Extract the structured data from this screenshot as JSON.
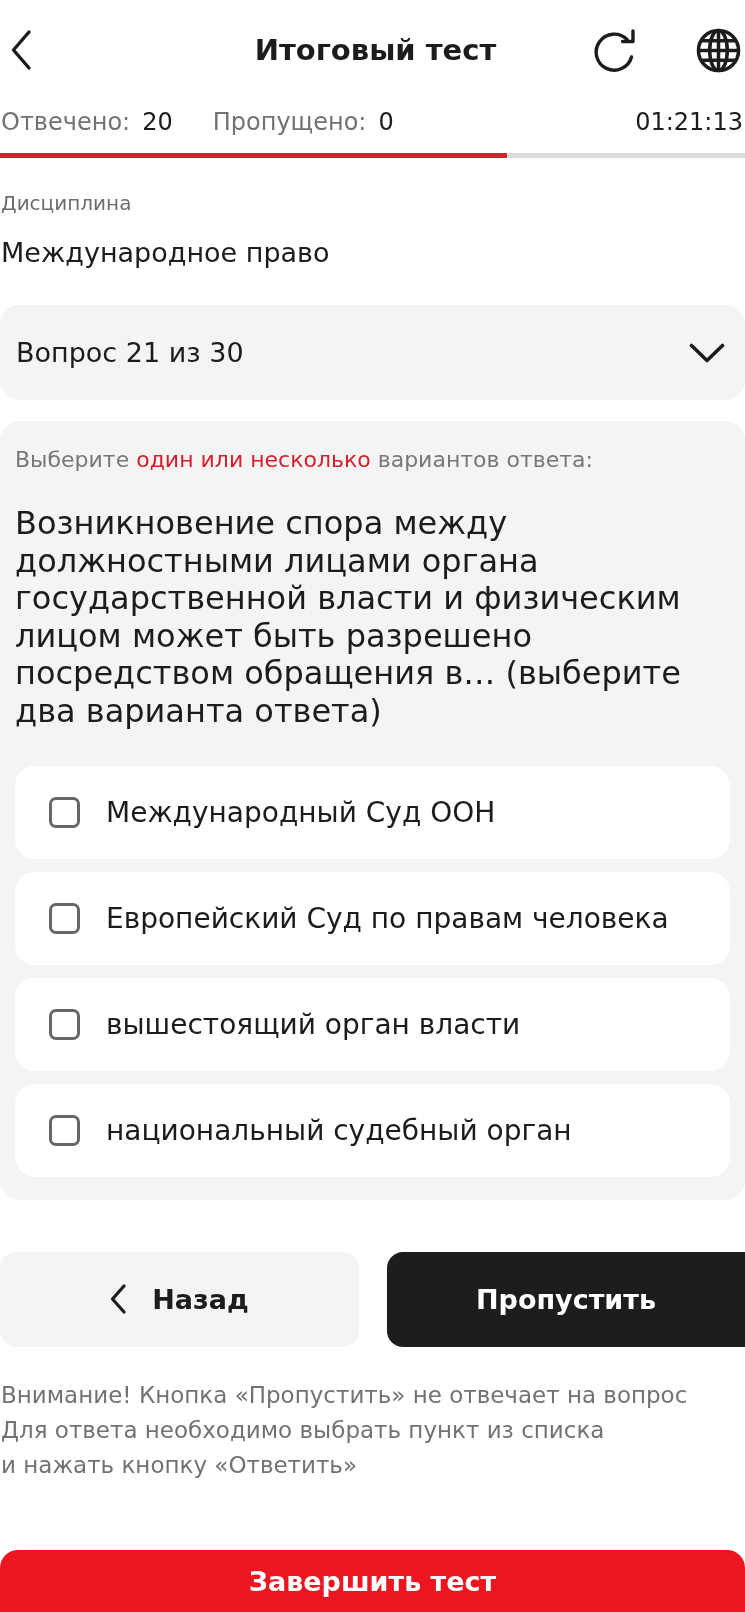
{
  "header": {
    "title": "Итоговый тест"
  },
  "stats": {
    "answered_label": "Отвечено:",
    "answered": "20",
    "skipped_label": "Пропущено:",
    "skipped": "0",
    "timer": "01:21:13"
  },
  "progress": {
    "level": 0.68
  },
  "discipline": {
    "label": "Дисциплина",
    "value": "Международное право"
  },
  "question_selector": {
    "value": "Вопрос 21 из 30",
    "expanded": false
  },
  "question": {
    "instruction": [
      {
        "text": "Выберите ",
        "highlight": false
      },
      {
        "text": "один или несколько",
        "highlight": true
      },
      {
        "text": " вариантов ответа:",
        "highlight": false
      }
    ],
    "text": "Возникновение спора между должностными лицами органа государственной власти и физическим лицом может быть разрешено посредством обращения в… (выберите два варианта ответа)",
    "options": [
      {
        "label": "Международный Суд ООН",
        "checked": false
      },
      {
        "label": "Европейский Суд по правам человека",
        "checked": false
      },
      {
        "label": "вышестоящий орган власти",
        "checked": false
      },
      {
        "label": "национальный судебный орган",
        "checked": false
      }
    ]
  },
  "navigation": {
    "back": "Назад",
    "skip": "Пропустить"
  },
  "notice": "Внимание! Кнопка «Пропустить» не отвечает на вопрос\nДля ответа необходимо выбрать пункт из списка\nи нажать кнопку «Ответить»",
  "finish_button": "Завершить тест"
}
